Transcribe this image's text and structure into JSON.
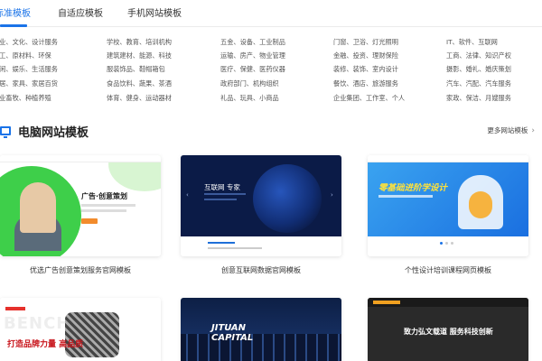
{
  "tabs": [
    {
      "label": "标准模板",
      "active": true
    },
    {
      "label": "自适应模板",
      "active": false
    },
    {
      "label": "手机网站模板",
      "active": false
    }
  ],
  "categories": [
    [
      "企业、文化、设计服务",
      "学校、教育、培训机构",
      "五金、设备、工业制品",
      "门窗、卫浴、灯光照明",
      "IT、软件、互联网"
    ],
    [
      "化工、原材料、环保",
      "建筑建材、能源、科技",
      "运输、房产、物业管理",
      "金融、投资、理财保险",
      "工商、法律、知识产权"
    ],
    [
      "休闲、娱乐、生活服务",
      "服装饰品、鞋帽箱包",
      "医疗、保健、医药仪器",
      "装修、装饰、室内设计",
      "摄影、婚礼、婚庆策划"
    ],
    [
      "家居、家具、家居百货",
      "食品饮料、蔬果、茶酒",
      "政府部门、机构组织",
      "餐饮、酒店、旅游服务",
      "汽车、汽配、汽车服务"
    ],
    [
      "农业畜牧、种植养殖",
      "体育、健身、运动器材",
      "礼品、玩具、小商品",
      "企业集团、工作室、个人",
      "家政、保洁、月嫂服务"
    ]
  ],
  "section": {
    "title": "电脑网站模板",
    "more": "更多网站模板",
    "icon": "monitor-icon"
  },
  "cards": [
    {
      "caption": "优选广告创意策划服务官网模板",
      "hero_text": "广告·创意策划"
    },
    {
      "caption": "创意互联网数据官网模板",
      "hero_text": "互联网 专家"
    },
    {
      "caption": "个性设计培训课程网页模板",
      "hero_text": "零基础进阶学设计"
    },
    {
      "caption": "",
      "hero_text": "打造品牌力量 高品质",
      "watermark": "BENCH"
    },
    {
      "caption": "",
      "hero_text": "JITUAN\nCAPITAL"
    },
    {
      "caption": "",
      "hero_text": "致力弘文载道 服务科技创新"
    }
  ],
  "colors": {
    "accent": "#1a73e8",
    "green": "#3ecf4a",
    "dark_blue": "#0b1b47"
  }
}
